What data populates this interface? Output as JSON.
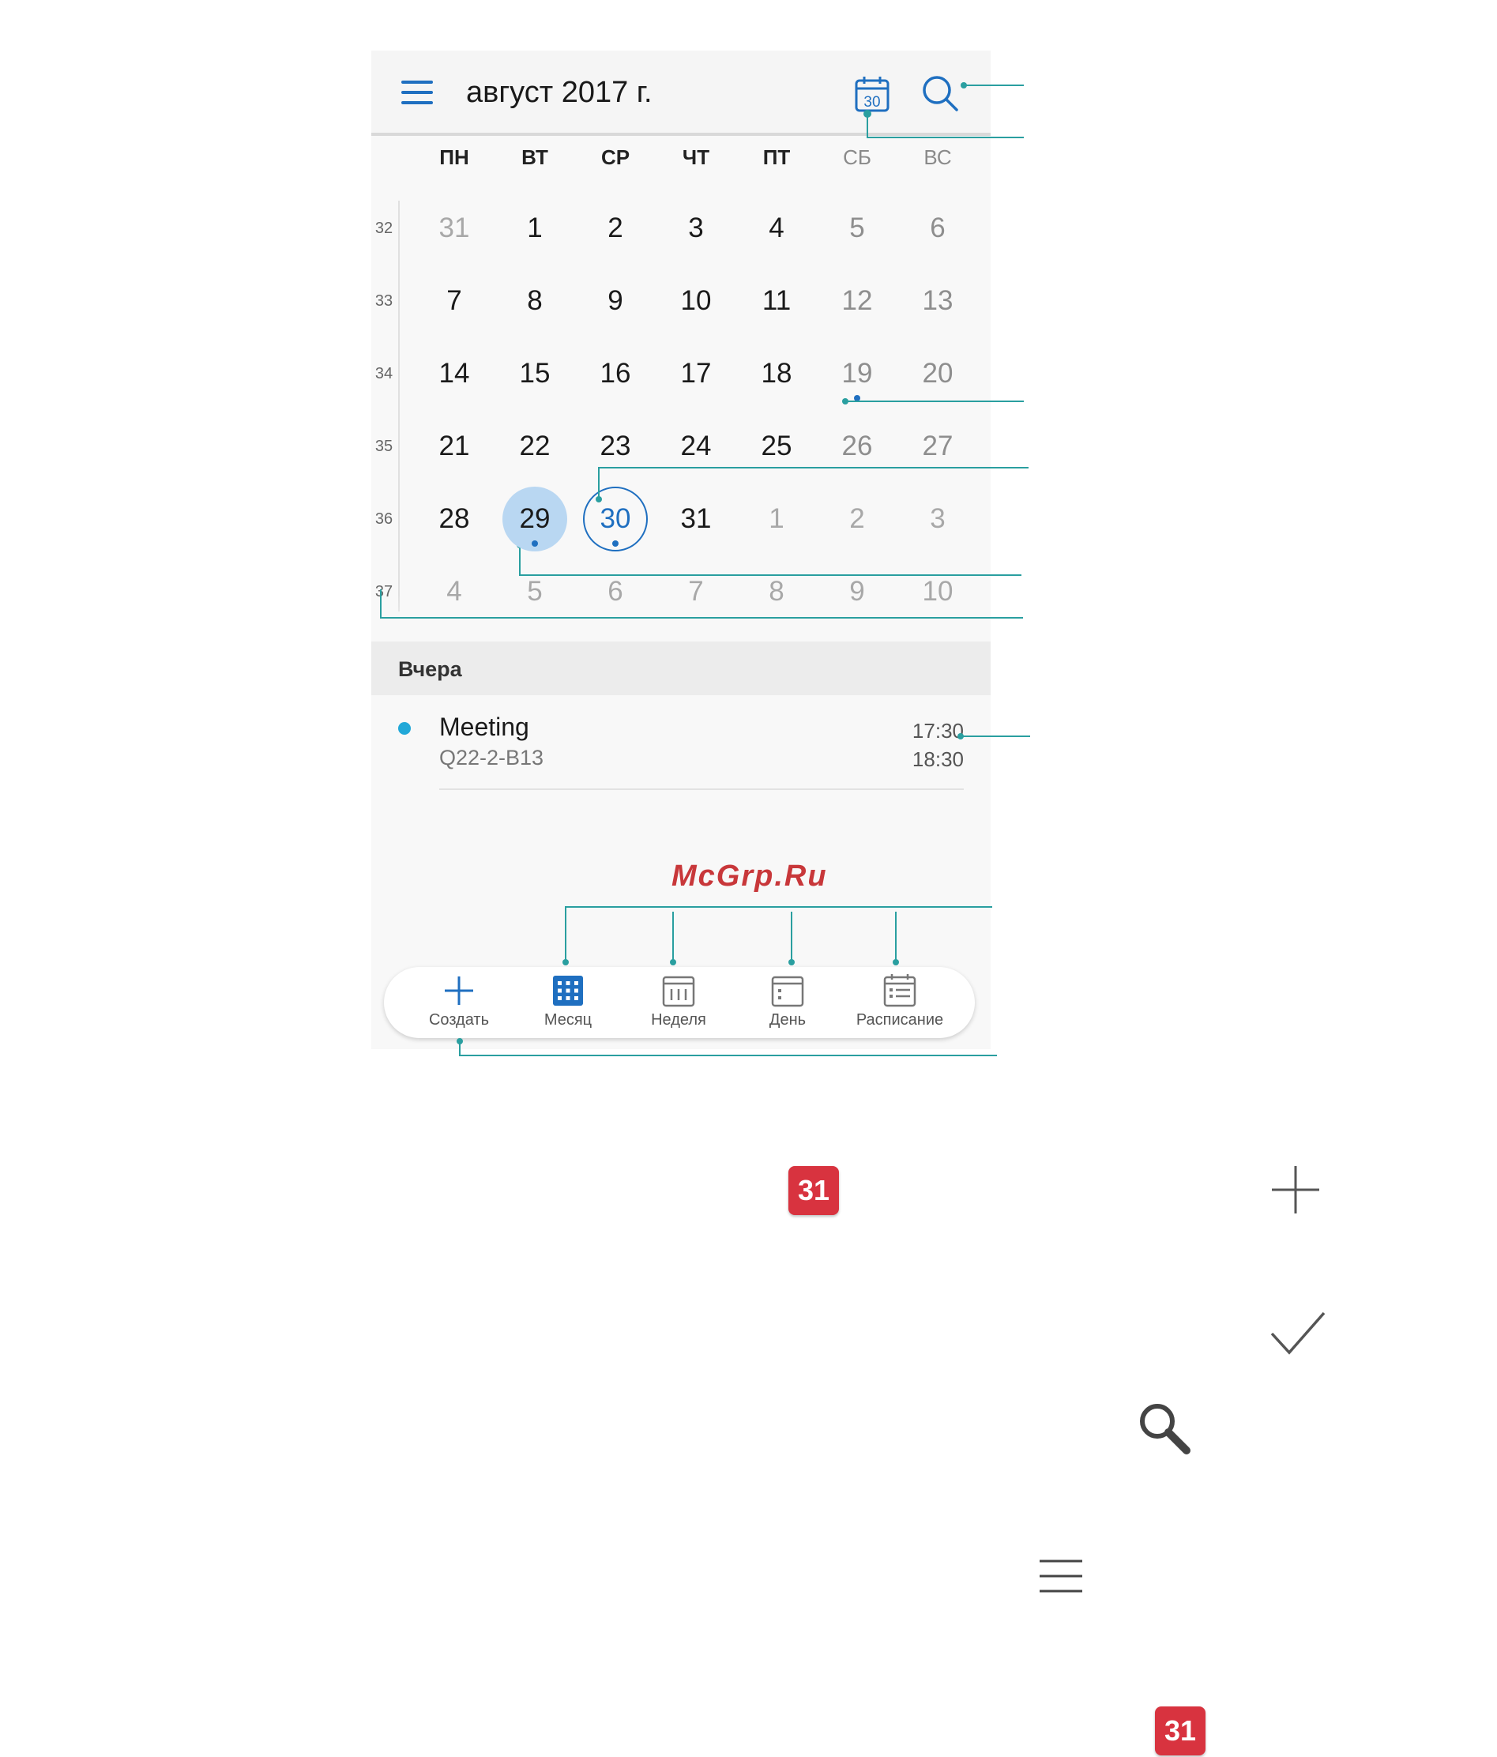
{
  "header": {
    "title": "август 2017 г.",
    "today_icon_number": "30",
    "icons": [
      "menu-icon",
      "today-calendar-icon",
      "search-icon"
    ]
  },
  "weekdays": [
    "ПН",
    "ВТ",
    "СР",
    "ЧТ",
    "ПТ",
    "СБ",
    "ВС"
  ],
  "weeks": [
    {
      "num": "32",
      "days": [
        "31",
        "1",
        "2",
        "3",
        "4",
        "5",
        "6"
      ]
    },
    {
      "num": "33",
      "days": [
        "7",
        "8",
        "9",
        "10",
        "11",
        "12",
        "13"
      ]
    },
    {
      "num": "34",
      "days": [
        "14",
        "15",
        "16",
        "17",
        "18",
        "19",
        "20"
      ]
    },
    {
      "num": "35",
      "days": [
        "21",
        "22",
        "23",
        "24",
        "25",
        "26",
        "27"
      ]
    },
    {
      "num": "36",
      "days": [
        "28",
        "29",
        "30",
        "31",
        "1",
        "2",
        "3"
      ]
    },
    {
      "num": "37",
      "days": [
        "4",
        "5",
        "6",
        "7",
        "8",
        "9",
        "10"
      ]
    }
  ],
  "selected_day": "29",
  "today_day": "30",
  "section": {
    "label": "Вчера"
  },
  "event": {
    "title": "Meeting",
    "location": "Q22-2-B13",
    "start": "17:30",
    "end": "18:30"
  },
  "tabs": [
    {
      "label": "Создать",
      "icon": "plus-icon"
    },
    {
      "label": "Месяц",
      "icon": "month-grid-icon"
    },
    {
      "label": "Неделя",
      "icon": "week-icon"
    },
    {
      "label": "День",
      "icon": "day-icon"
    },
    {
      "label": "Расписание",
      "icon": "schedule-list-icon"
    }
  ],
  "watermark": "McGrp.Ru",
  "legend_glyphs": {
    "calendar_badge_number": "31",
    "icons": [
      "plus-icon",
      "checkmark-icon",
      "search-icon",
      "menu-icon",
      "calendar-app-icon"
    ]
  },
  "colors": {
    "accent": "#1f6fc0",
    "selected_fill": "#b9d7f2",
    "event_dot": "#21a8d8",
    "callout_line": "#2a9fa0",
    "badge_red": "#d8333f"
  }
}
